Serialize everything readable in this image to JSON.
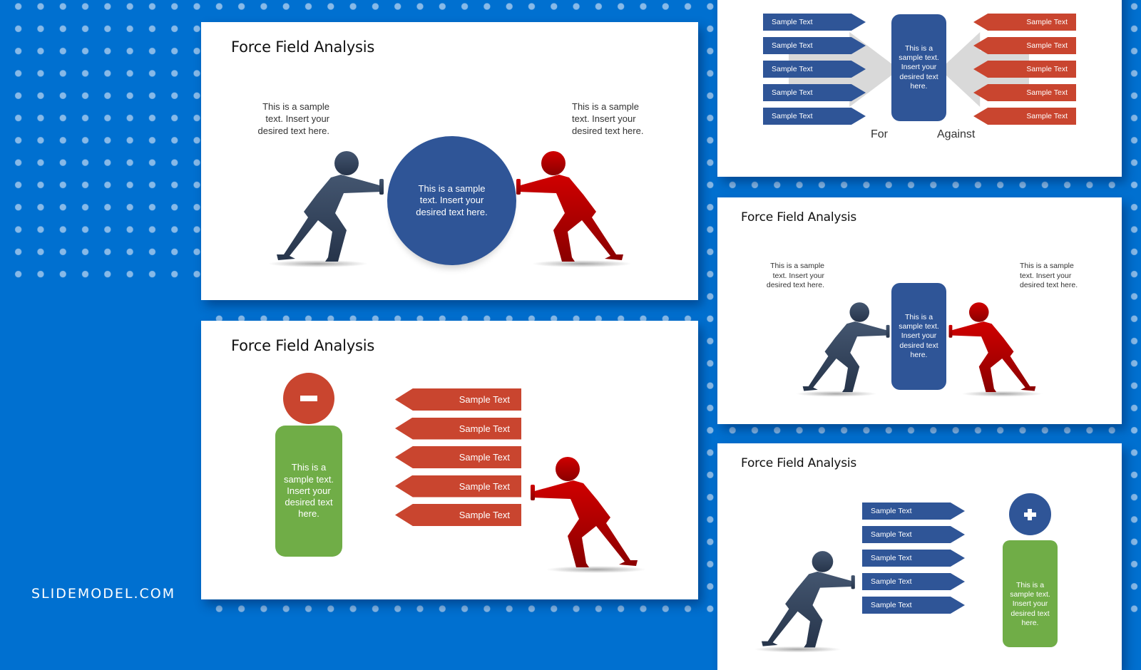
{
  "brand": {
    "logo_text": "SLIDEMODEL.COM"
  },
  "colors": {
    "background": "#0070d0",
    "navy": "#2f5597",
    "figure_blue": "#3d5068",
    "figure_red": "#c00000",
    "arrow_red": "#c9452f",
    "green": "#70ad47"
  },
  "slides": {
    "main": {
      "title": "Force Field Analysis",
      "left_text": [
        "This is a sample",
        "text. Insert your",
        "desired text here."
      ],
      "right_text": [
        "This is a sample",
        "text. Insert your",
        "desired text here."
      ],
      "center_text": [
        "This is a sample",
        "text. Insert your",
        "desired text here."
      ]
    },
    "against": {
      "title": "Force Field Analysis",
      "minus_icon": "minus-icon",
      "box_text": [
        "This is a",
        "sample text.",
        "Insert your",
        "desired text",
        "here."
      ],
      "arrows": [
        "Sample Text",
        "Sample Text",
        "Sample Text",
        "Sample Text",
        "Sample Text"
      ]
    },
    "for_against": {
      "for_arrows": [
        "Sample Text",
        "Sample Text",
        "Sample Text",
        "Sample Text",
        "Sample Text"
      ],
      "against_arrows": [
        "Sample Text",
        "Sample Text",
        "Sample Text",
        "Sample Text",
        "Sample Text"
      ],
      "center_text": [
        "This is a",
        "sample text.",
        "Insert your",
        "desired text",
        "here."
      ],
      "for_label": "For",
      "against_label": "Against"
    },
    "pillar": {
      "title": "Force Field Analysis",
      "left_text": [
        "This is a sample",
        "text. Insert your",
        "desired text here."
      ],
      "right_text": [
        "This is a sample",
        "text. Insert your",
        "desired text here."
      ],
      "center_text": [
        "This is a",
        "sample text.",
        "Insert your",
        "desired text",
        "here."
      ]
    },
    "for": {
      "title": "Force Field Analysis",
      "plus_icon": "plus-icon",
      "arrows": [
        "Sample Text",
        "Sample Text",
        "Sample Text",
        "Sample Text",
        "Sample Text"
      ],
      "box_text": [
        "This is a",
        "sample text.",
        "Insert your",
        "desired text",
        "here."
      ]
    }
  }
}
